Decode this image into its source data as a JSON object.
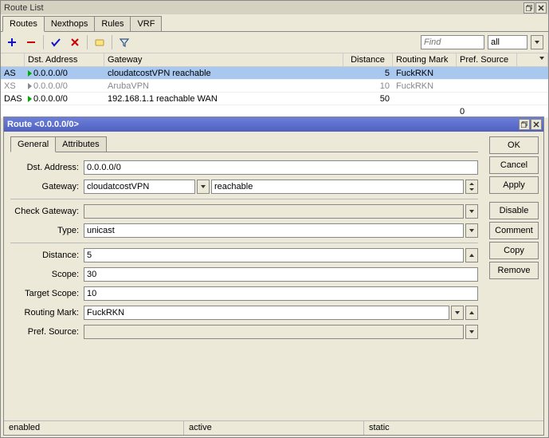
{
  "main_window": {
    "title": "Route List",
    "tabs": [
      "Routes",
      "Nexthops",
      "Rules",
      "VRF"
    ],
    "active_tab": 0,
    "find_placeholder": "Find",
    "filter_value": "all",
    "columns": [
      "Dst. Address",
      "Gateway",
      "Distance",
      "Routing Mark",
      "Pref. Source"
    ],
    "rows": [
      {
        "flags": "AS",
        "active": true,
        "dst": "0.0.0.0/0",
        "gw": "cloudatcostVPN reachable",
        "dist": "5",
        "rm": "FuckRKN",
        "ps": ""
      },
      {
        "flags": "XS",
        "active": false,
        "dst": "0.0.0.0/0",
        "gw": "ArubaVPN",
        "dist": "10",
        "rm": "FuckRKN",
        "ps": ""
      },
      {
        "flags": "DAS",
        "active": true,
        "dst": "0.0.0.0/0",
        "gw": "192.168.1.1 reachable WAN",
        "dist": "50",
        "rm": "",
        "ps": ""
      }
    ],
    "items_total": "0"
  },
  "dialog": {
    "title": "Route <0.0.0.0/0>",
    "tabs": [
      "General",
      "Attributes"
    ],
    "active_tab": 0,
    "labels": {
      "dst": "Dst. Address:",
      "gw": "Gateway:",
      "chk": "Check Gateway:",
      "type": "Type:",
      "dist": "Distance:",
      "scope": "Scope:",
      "tscope": "Target Scope:",
      "rm": "Routing Mark:",
      "ps": "Pref. Source:"
    },
    "values": {
      "dst": "0.0.0.0/0",
      "gw": "cloudatcostVPN",
      "gw_status": "reachable",
      "chk": "",
      "type": "unicast",
      "dist": "5",
      "scope": "30",
      "tscope": "10",
      "rm": "FuckRKN",
      "ps": ""
    },
    "buttons": {
      "ok": "OK",
      "cancel": "Cancel",
      "apply": "Apply",
      "disable": "Disable",
      "comment": "Comment",
      "copy": "Copy",
      "remove": "Remove"
    },
    "status": {
      "s1": "enabled",
      "s2": "active",
      "s3": "static"
    }
  }
}
